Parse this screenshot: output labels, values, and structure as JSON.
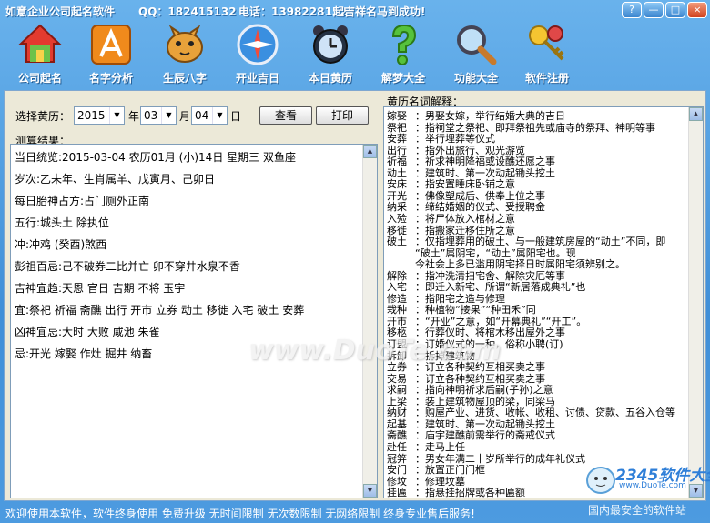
{
  "titlebar": {
    "app_name": "如意企业公司起名软件",
    "qq": "QQ：182415132",
    "phone": "电话：13982281527",
    "slogan": "起吉祥名马到成功!",
    "btn_help": "?",
    "btn_min": "—",
    "btn_max": "□",
    "btn_close": "×"
  },
  "toolbar": [
    {
      "label": "公司起名",
      "icon": "house-icon",
      "name": "tool-company-naming"
    },
    {
      "label": "名字分析",
      "icon": "ruler-icon",
      "name": "tool-name-analysis"
    },
    {
      "label": "生辰八字",
      "icon": "tiger-icon",
      "name": "tool-birth-chart"
    },
    {
      "label": "开业吉日",
      "icon": "compass-icon",
      "name": "tool-opening-day"
    },
    {
      "label": "本日黄历",
      "icon": "alarm-clock-icon",
      "name": "tool-daily-almanac"
    },
    {
      "label": "解梦大全",
      "icon": "question-icon",
      "name": "tool-dream-interpret"
    },
    {
      "label": "功能大全",
      "icon": "magnifier-icon",
      "name": "tool-all-functions"
    },
    {
      "label": "软件注册",
      "icon": "keys-icon",
      "name": "tool-register"
    }
  ],
  "select": {
    "label": "选择黄历：",
    "year": "2015",
    "year_unit": "年",
    "month": "03",
    "month_unit": "月",
    "day": "04",
    "day_unit": "日",
    "query_btn": "查看",
    "print_btn": "打印"
  },
  "result": {
    "title": "测算结果：",
    "lines": [
      "当日统览:2015-03-04   农历01月 (小)14日  星期三  双鱼座",
      "岁次:乙未年、生肖属羊、戊寅月、己卯日",
      "每日胎神占方:占门厕外正南",
      "五行:城头土  除执位",
      "冲:冲鸡 (癸酉)煞西",
      "彭祖百忌:己不破券二比并亡  卯不穿井水泉不香",
      "吉神宜趋:天恩  官日  吉期  不将  玉宇",
      "宜:祭祀  祈福  斋醮  出行  开市  立券  动土  移徙  入宅  破土  安葬",
      "凶神宜忌:大时  大败  咸池  朱雀",
      "忌:开光  嫁娶  作灶  掘井  纳畜"
    ]
  },
  "lexicon": {
    "title": "黄历名词解释：",
    "rows": [
      {
        "t": "嫁娶",
        "d": "：男娶女嫁，举行结婚大典的吉日"
      },
      {
        "t": "祭祀",
        "d": "：指祠堂之祭祀、即拜祭祖先或庙寺的祭拜、神明等事"
      },
      {
        "t": "安葬",
        "d": "：举行埋葬等仪式"
      },
      {
        "t": "出行",
        "d": "：指外出旅行、观光游览"
      },
      {
        "t": "祈福",
        "d": "：祈求神明降福或设醮还愿之事"
      },
      {
        "t": "动土",
        "d": "：建筑时、第一次动起锄头挖土"
      },
      {
        "t": "安床",
        "d": "：指安置睡床卧铺之意"
      },
      {
        "t": "开光",
        "d": "：佛像塑成后、供奉上位之事"
      },
      {
        "t": "纳采",
        "d": "：缔结婚姻的仪式、受授聘金"
      },
      {
        "t": "入殓",
        "d": "：将尸体放入棺材之意"
      },
      {
        "t": "移徙",
        "d": "：指搬家迁移住所之意"
      },
      {
        "t": "破土",
        "d": "：仅指埋葬用的破土、与一般建筑房屋的“动土”不同，即"
      },
      {
        "t": "",
        "d": "“破土”属阴宅，“动土”属阳宅也。现"
      },
      {
        "t": "",
        "d": "今社会上多已滥用阴宅择日时属阳宅须辨别之。"
      },
      {
        "t": "解除",
        "d": "：指冲洗清扫宅舍、解除灾厄等事"
      },
      {
        "t": "入宅",
        "d": "：即迁入新宅、所谓“新居落成典礼”也"
      },
      {
        "t": "修造",
        "d": "：指阳宅之造与修理"
      },
      {
        "t": "栽种",
        "d": "：种植物“接果”“种田禾”同"
      },
      {
        "t": "开市",
        "d": "：“开业”之意，如“开幕典礼”“开工”。"
      },
      {
        "t": "移柩",
        "d": "：行葬仪时、将棺木移出屋外之事"
      },
      {
        "t": "订盟",
        "d": "：订婚仪式的一种，俗称小聘(订)"
      },
      {
        "t": "拆卸",
        "d": "：拆掉建筑物"
      },
      {
        "t": "立券",
        "d": "：订立各种契约互相买卖之事"
      },
      {
        "t": "交易",
        "d": "：订立各种契约互相买卖之事"
      },
      {
        "t": "求嗣",
        "d": "：指向神明祈求后嗣(子孙)之意"
      },
      {
        "t": "上梁",
        "d": "：装上建筑物屋顶的梁，同梁马"
      },
      {
        "t": "纳财",
        "d": "：购屋产业、进货、收帐、收租、讨债、贷款、五谷入仓等"
      },
      {
        "t": "起基",
        "d": "：建筑时、第一次动起锄头挖土"
      },
      {
        "t": "斋醮",
        "d": "：庙宇建醮前需举行的斋戒仪式"
      },
      {
        "t": "赴任",
        "d": "：走马上任"
      },
      {
        "t": "冠笄",
        "d": "：男女年满二十岁所举行的成年礼仪式"
      },
      {
        "t": "安门",
        "d": "：放置正门门框"
      },
      {
        "t": "修坟",
        "d": "：修理坟墓"
      },
      {
        "t": "挂匾",
        "d": "：指悬挂招牌或各种匾额"
      }
    ]
  },
  "status": "欢迎使用本软件，软件终身使用  免费升级  无时间限制  无次数限制  无网络限制  终身专业售后服务!",
  "watermark": "www.DuoTe.com",
  "logo": {
    "big": "2345软件大全",
    "small": "www.DuoTe.com",
    "slogan": "国内最安全的软件站"
  }
}
